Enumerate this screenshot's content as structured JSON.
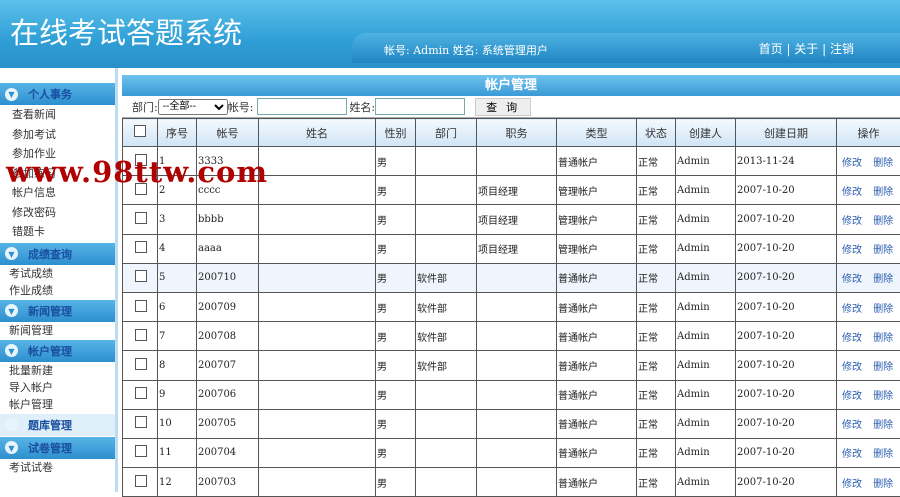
{
  "header": {
    "title": "在线考试答题系统",
    "user_info": "帐号:  Admin 姓名:  系统管理用户",
    "links": [
      "首页",
      "关于",
      "注销"
    ]
  },
  "watermark": "www.98ttw.com",
  "sidebar": [
    {
      "title": "个人事务",
      "items": [
        "查看新闻",
        "参加考试",
        "参加作业",
        "参加练习",
        "帐户信息",
        "修改密码",
        "错题卡"
      ]
    },
    {
      "title": "成绩查询",
      "items": [
        "考试成绩",
        "作业成绩"
      ]
    },
    {
      "title": "新闻管理",
      "items": [
        "新闻管理"
      ]
    },
    {
      "title": "帐户管理",
      "items": [
        "批量新建",
        "导入帐户",
        "帐户管理"
      ]
    },
    {
      "title": "题库管理",
      "items": []
    },
    {
      "title": "试卷管理",
      "items": [
        "考试试卷"
      ]
    }
  ],
  "page": {
    "title": "帐户管理",
    "search": {
      "dept_label": "部门:",
      "dept_value": "--全部--",
      "account_label": "帐号:",
      "name_label": "姓名:",
      "query_button": "查 询"
    },
    "columns": [
      "序号",
      "帐号",
      "姓名",
      "性别",
      "部门",
      "职务",
      "类型",
      "状态",
      "创建人",
      "创建日期",
      "操作"
    ],
    "edit_label": "修改",
    "delete_label": "删除",
    "rows": [
      [
        "1",
        "3333",
        "",
        "男",
        "",
        "",
        "普通帐户",
        "正常",
        "Admin",
        "2013-11-24"
      ],
      [
        "2",
        "cccc",
        "",
        "男",
        "",
        "项目经理",
        "管理帐户",
        "正常",
        "Admin",
        "2007-10-20"
      ],
      [
        "3",
        "bbbb",
        "",
        "男",
        "",
        "项目经理",
        "管理帐户",
        "正常",
        "Admin",
        "2007-10-20"
      ],
      [
        "4",
        "aaaa",
        "",
        "男",
        "",
        "项目经理",
        "管理帐户",
        "正常",
        "Admin",
        "2007-10-20"
      ],
      [
        "5",
        "200710",
        "",
        "男",
        "软件部",
        "",
        "普通帐户",
        "正常",
        "Admin",
        "2007-10-20"
      ],
      [
        "6",
        "200709",
        "",
        "男",
        "软件部",
        "",
        "普通帐户",
        "正常",
        "Admin",
        "2007-10-20"
      ],
      [
        "7",
        "200708",
        "",
        "男",
        "软件部",
        "",
        "普通帐户",
        "正常",
        "Admin",
        "2007-10-20"
      ],
      [
        "8",
        "200707",
        "",
        "男",
        "软件部",
        "",
        "普通帐户",
        "正常",
        "Admin",
        "2007-10-20"
      ],
      [
        "9",
        "200706",
        "",
        "男",
        "",
        "",
        "普通帐户",
        "正常",
        "Admin",
        "2007-10-20"
      ],
      [
        "10",
        "200705",
        "",
        "男",
        "",
        "",
        "普通帐户",
        "正常",
        "Admin",
        "2007-10-20"
      ],
      [
        "11",
        "200704",
        "",
        "男",
        "",
        "",
        "普通帐户",
        "正常",
        "Admin",
        "2007-10-20"
      ],
      [
        "12",
        "200703",
        "",
        "男",
        "",
        "",
        "普通帐户",
        "正常",
        "Admin",
        "2007-10-20"
      ]
    ]
  }
}
